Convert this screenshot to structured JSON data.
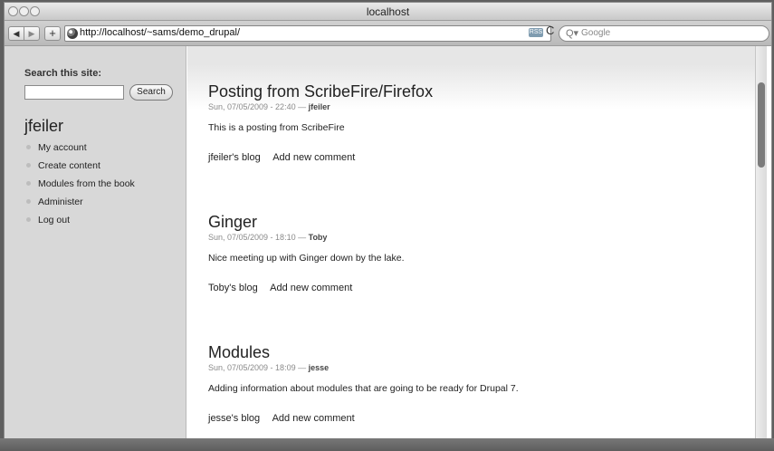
{
  "window": {
    "title": "localhost"
  },
  "toolbar": {
    "back": "◀",
    "forward": "▶",
    "add": "+",
    "url": "http://localhost/~sams/demo_drupal/",
    "rss": "RSS",
    "reload": "C",
    "search_mag": "Q▾",
    "search_placeholder": "Google"
  },
  "sidebar": {
    "search_label": "Search this site:",
    "search_button": "Search",
    "user": "jfeiler",
    "items": [
      {
        "label": "My account"
      },
      {
        "label": "Create content"
      },
      {
        "label": "Modules from the book"
      },
      {
        "label": "Administer"
      },
      {
        "label": "Log out"
      }
    ]
  },
  "posts": [
    {
      "title": "Posting from ScribeFire/Firefox",
      "meta": "Sun, 07/05/2009 - 22:40 —",
      "author": "jfeiler",
      "body": "This is a posting from ScribeFire",
      "blog": "jfeiler's blog",
      "comment": "Add new comment"
    },
    {
      "title": "Ginger",
      "meta": "Sun, 07/05/2009 - 18:10 —",
      "author": "Toby",
      "body": "Nice meeting up with Ginger down by the lake.",
      "blog": "Toby's blog",
      "comment": "Add new comment"
    },
    {
      "title": "Modules",
      "meta": "Sun, 07/05/2009 - 18:09 —",
      "author": "jesse",
      "body": "Adding information about modules that are going to be ready for Drupal 7.",
      "blog": "jesse's blog",
      "comment": "Add new comment"
    }
  ],
  "colors": {
    "chrome": "#d8d8d8",
    "page": "#ffffff",
    "text": "#222222",
    "meta": "#8a8a8a",
    "rss": "#7f9cb0"
  }
}
